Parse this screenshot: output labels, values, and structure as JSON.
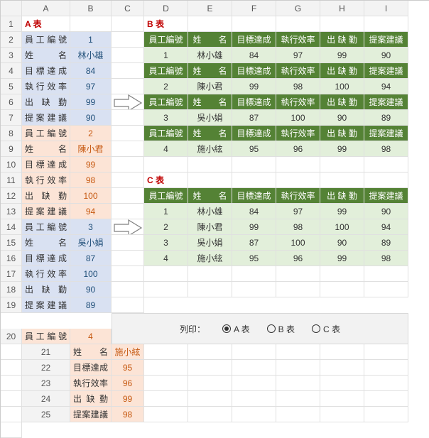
{
  "columns": [
    "A",
    "B",
    "C",
    "D",
    "E",
    "F",
    "G",
    "H",
    "I"
  ],
  "rows_count": 25,
  "titleA": "A 表",
  "titleB": "B 表",
  "titleC": "C 表",
  "fields": [
    "員工編號",
    "姓　　名",
    "目標達成",
    "執行效率",
    "出 缺 勤",
    "提案建議"
  ],
  "tableA": [
    {
      "id": "1",
      "name": "林小雄",
      "v": [
        "84",
        "97",
        "99",
        "90"
      ]
    },
    {
      "id": "2",
      "name": "陳小君",
      "v": [
        "99",
        "98",
        "100",
        "94"
      ]
    },
    {
      "id": "3",
      "name": "吳小娟",
      "v": [
        "87",
        "100",
        "90",
        "89"
      ]
    },
    {
      "id": "4",
      "name": "施小絃",
      "v": [
        "95",
        "96",
        "99",
        "98"
      ]
    }
  ],
  "headersB": [
    "員工編號",
    "姓　　名",
    "目標達成",
    "執行效率",
    "出 缺 勤",
    "提案建議"
  ],
  "print_label": "列印：",
  "radio": {
    "options": [
      "A 表",
      "B 表",
      "C 表"
    ],
    "selected": "A 表"
  }
}
